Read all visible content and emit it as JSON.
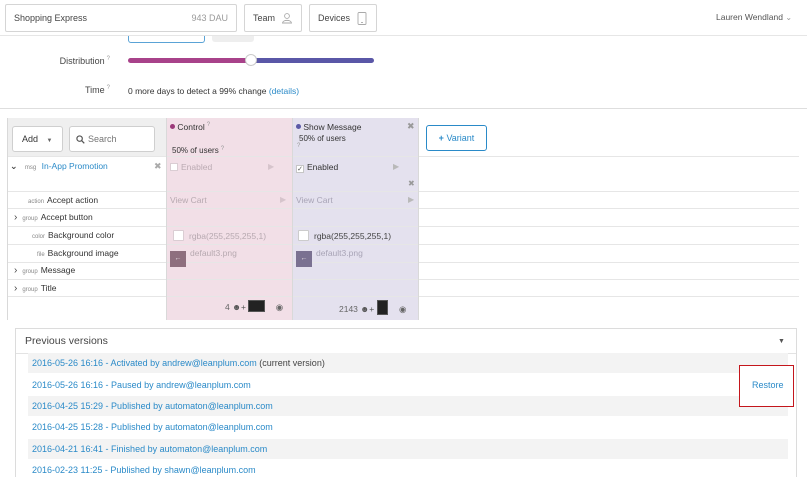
{
  "topbar": {
    "app_name": "Shopping Express",
    "dau": "943 DAU",
    "team_label": "Team",
    "devices_label": "Devices",
    "user_name": "Lauren Wendland"
  },
  "settings": {
    "distribution_label": "Distribution",
    "distribution_split": 0.5,
    "time_label": "Time",
    "time_text": "0 more days to detect a 99% change",
    "details_link": "(details)"
  },
  "toolbar": {
    "add_label": "Add",
    "search_placeholder": "Search",
    "variant_button": "Variant"
  },
  "variants": [
    {
      "name": "Control",
      "users": "50% of users",
      "color": "#9c3a7a"
    },
    {
      "name": "Show Message",
      "users": "50% of users",
      "color": "#5b5aa6"
    }
  ],
  "message": {
    "kind": "msg",
    "name": "In-App Promotion",
    "control_state": "Enabled",
    "show_state": "Enabled"
  },
  "rows": [
    {
      "kind": "action",
      "label": "Accept action",
      "control": "View Cart",
      "show": "View Cart"
    },
    {
      "kind": "group",
      "label": "Accept button"
    },
    {
      "kind": "color",
      "label": "Background color",
      "control": "rgba(255,255,255,1)",
      "show": "rgba(255,255,255,1)"
    },
    {
      "kind": "file",
      "label": "Background image",
      "control": "default3.png",
      "show": "default3.png"
    },
    {
      "kind": "group",
      "label": "Message"
    },
    {
      "kind": "group",
      "label": "Title"
    }
  ],
  "footer_counts": {
    "control": "4",
    "show": "2143"
  },
  "versions": {
    "title": "Previous versions",
    "restore_label": "Restore",
    "items": [
      {
        "text": "2016-05-26 16:16 - Activated by andrew@leanplum.com",
        "suffix": "(current version)"
      },
      {
        "text": "2016-05-26 16:16 - Paused by andrew@leanplum.com",
        "suffix": ""
      },
      {
        "text": "2016-04-25 15:29 - Published by automaton@leanplum.com",
        "suffix": ""
      },
      {
        "text": "2016-04-25 15:28 - Published by automaton@leanplum.com",
        "suffix": ""
      },
      {
        "text": "2016-04-21 16:41 - Finished by automaton@leanplum.com",
        "suffix": ""
      },
      {
        "text": "2016-02-23 11:25 - Published by shawn@leanplum.com",
        "suffix": ""
      }
    ]
  },
  "colors": {
    "accent": "#2a8ac8",
    "control_column": "#f2dfe7",
    "show_column": "#e4e1ee",
    "highlight_box": "#c4161c"
  }
}
